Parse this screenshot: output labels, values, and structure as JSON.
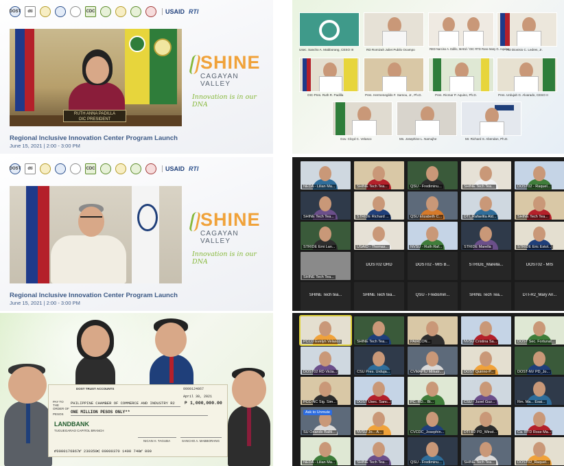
{
  "logos": [
    "DOST",
    "dti",
    "",
    "",
    "",
    "CDC",
    "",
    "",
    "",
    ""
  ],
  "usaid": "USAID",
  "rti": "RTI",
  "brand": {
    "name": "SHINE",
    "subtitle": "CAGAYAN VALLEY",
    "tagline": "Innovation is in our DNA"
  },
  "event": {
    "title": "Regional Inclusive Innovation Center Program Launch",
    "datetime": "June 15, 2021  |  2:00 - 3:00 PM"
  },
  "speaker1": {
    "nameplate_line1": "RUTH ANNA PADILLA",
    "nameplate_line2": "OIC PRESIDENT"
  },
  "signing": {
    "captions": [
      "Usec. Sancho A. Mabborang, CESO III",
      "RD Romizah Juliet Pubilo Ocampo",
      "RED Narciso A. Edillo, MAEd / OIC RTD Rose Mary G. Aquino",
      "RD Dionisio C. Ledres, Jr.",
      "OIC-Pres. Ruth R. Padilla",
      "Pres. Hermenegildo F. Samou, Jr., Ph.D.",
      "Pres. Ricmar P. Aquino, Ph.D.",
      "Pres. Urdujah G. Alvarado, CESO II",
      "Gov. Cloyd C. Velasco",
      "Ms. Josephine L. Namujhe",
      "Mr. Richard S. Abendan, Ph.D."
    ]
  },
  "zoom1": {
    "tiles": [
      {
        "name": "NEDA - Lilian Ma..."
      },
      {
        "name": "SHINE Tech Tea..."
      },
      {
        "name": "QSU - Frediminu..."
      },
      {
        "name": "SHINE Tech Tea..."
      },
      {
        "name": "DOST02 - Raquel..."
      },
      {
        "name": "SHINE Tech Tea..."
      },
      {
        "name": "STRIDE Richard ..."
      },
      {
        "name": "QSU Elizabeth C..."
      },
      {
        "name": "DTI_Rafaelita Ald..."
      },
      {
        "name": "SHINE Tech Tea..."
      },
      {
        "name": "STRIDE Emi Lan..."
      },
      {
        "name": "USAID - Thomas..."
      },
      {
        "name": "NVSU - Ruth Raf..."
      },
      {
        "name": "STRIDE Marella"
      },
      {
        "name": "STRIDE Eric Estol..."
      },
      {
        "name": "SHINE Tech Tea..."
      }
    ],
    "dark_tiles": [
      "DOST02 ORD",
      "DOST02 - MIS B...",
      "STRIDE_Marella...",
      "DOST02 - MIS",
      "SHINE Tech tea...",
      "SHINE Tech tea...",
      "QSU - Fredismin...",
      "SHINE Tech Tea...",
      "DTI-R2_Mary An..."
    ]
  },
  "zoom2": {
    "tiles": [
      {
        "name": "PCCD Evelyn Velasco"
      },
      {
        "name": "SHINE Tech Tea..."
      },
      {
        "name": "PAIRCON..."
      },
      {
        "name": "NVSU Cristina Sa..."
      },
      {
        "name": "DOST Sec. Fortunat..."
      },
      {
        "name": "DOST02 RD Victa..."
      },
      {
        "name": "CSU Pres. Urduja..."
      },
      {
        "name": "CVMAPIU Milkatr..."
      },
      {
        "name": "DOST Quirino-P..."
      },
      {
        "name": "DOST-NV PD_Jo..."
      },
      {
        "name": "PCC-NC Sig. Sim..."
      },
      {
        "name": "DOST Usec. Sanc..."
      },
      {
        "name": "PC. RD... Bi..."
      },
      {
        "name": "CSU - Juvel Guz..."
      },
      {
        "name": "Rm. Ma... Esai..."
      },
      {
        "name": "SU Orlando Baliti..."
      },
      {
        "name": "NVSU Jo... A..."
      },
      {
        "name": "CVCDC_Josephin..."
      },
      {
        "name": "DTI R2 PD_Winst..."
      },
      {
        "name": "Ca. RTD Rose Ma..."
      },
      {
        "name": "NEDA - Lilian Ma..."
      },
      {
        "name": "SHINE Tech Tea..."
      },
      {
        "name": "QSU - Frediminu..."
      },
      {
        "name": "SHINE Tech Tea..."
      },
      {
        "name": "DOST02_Raquel..."
      }
    ],
    "overlay_button": "Ask to Unmute"
  },
  "cheque": {
    "bank_header": "DOST TRUST ACCOUNTS",
    "pay_label": "PAY TO THE ORDER OF",
    "payee": "PHILIPPINE CHAMBER OF COMMERCE AND INDUSTRY R2",
    "date": "April 30, 2021",
    "amount": "1,000,000.00",
    "peso_sign": "₱",
    "amount_words": "ONE MILLION PESOS ONLY**",
    "pesos_label": "PESOS",
    "bank": "LANDBANK",
    "branch": "TUGUEGARAO CAPITOL BRANCH",
    "check_no": "0000124867",
    "signer1": "NICAN H. TAGUBA",
    "signer2": "SANCHO A. MABBORANG",
    "micr": "⑈0000176867⑈ 230350⑆ 00000370 1400 740⑈ 000"
  },
  "colors": {
    "shine_orange": "#f0a23a",
    "shine_green": "#86b83a",
    "event_blue": "#3d5a86",
    "zoom_bg": "#1b1b1b",
    "speaker_highlight": "#e1d33a"
  }
}
